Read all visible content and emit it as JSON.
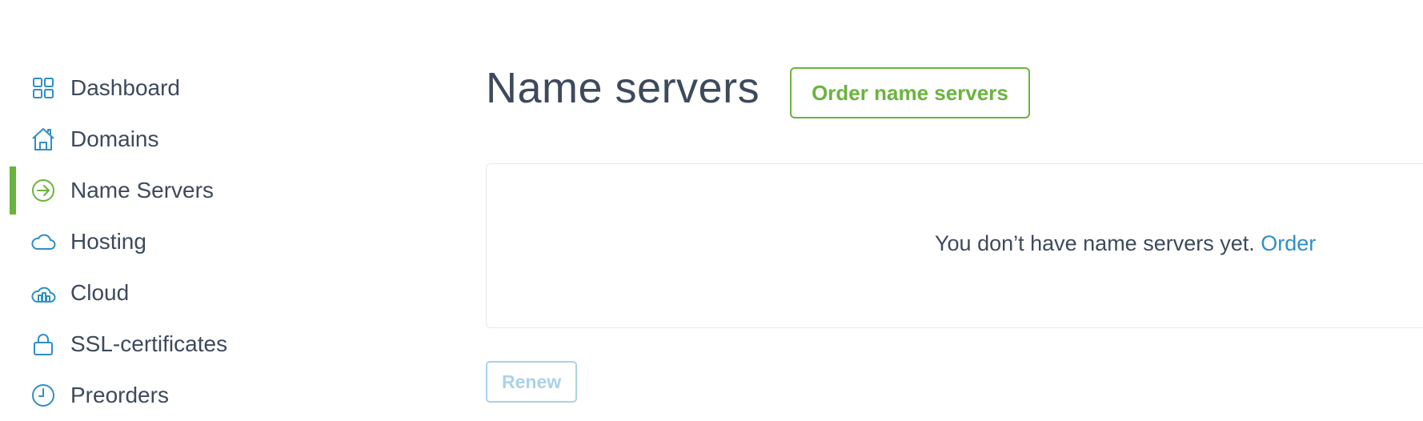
{
  "colors": {
    "accent_green": "#6ab43e",
    "link_blue": "#2f8fc8",
    "icon_blue": "#2f8fc8",
    "disabled_blue": "#a9d2ea",
    "text_dark": "#3d4a5c"
  },
  "sidebar": {
    "items": [
      {
        "label": "Dashboard",
        "icon": "dashboard-grid-icon",
        "active": false
      },
      {
        "label": "Domains",
        "icon": "house-icon",
        "active": false
      },
      {
        "label": "Name Servers",
        "icon": "arrow-circle-icon",
        "active": true
      },
      {
        "label": "Hosting",
        "icon": "cloud-icon",
        "active": false
      },
      {
        "label": "Cloud",
        "icon": "cloud-server-icon",
        "active": false
      },
      {
        "label": "SSL-certificates",
        "icon": "lock-icon",
        "active": false
      },
      {
        "label": "Preorders",
        "icon": "clock-icon",
        "active": false
      }
    ]
  },
  "main": {
    "title": "Name servers",
    "order_button": "Order name servers",
    "empty_state": {
      "message": "You don’t have name servers yet.",
      "link": "Order"
    },
    "renew_button": "Renew"
  }
}
